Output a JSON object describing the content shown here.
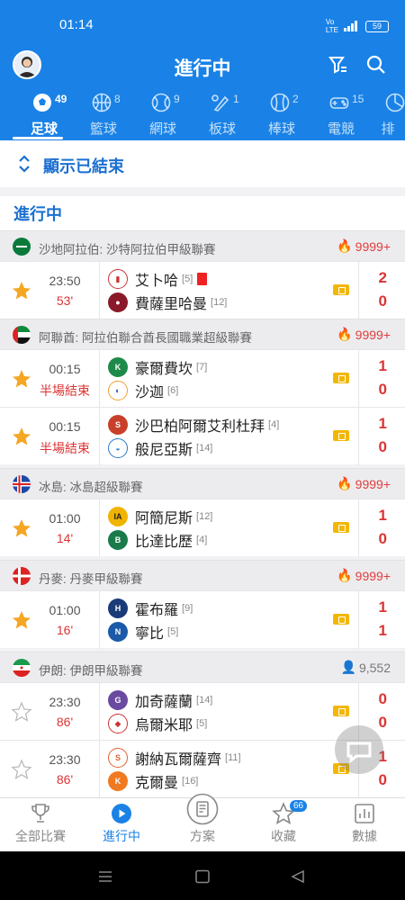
{
  "status": {
    "time": "01:14",
    "battery": "59"
  },
  "header": {
    "title": "進行中"
  },
  "sport_tabs": [
    {
      "label": "足球",
      "count": "49",
      "icon": "soccer-icon"
    },
    {
      "label": "籃球",
      "count": "8",
      "icon": "basketball-icon"
    },
    {
      "label": "網球",
      "count": "9",
      "icon": "tennis-icon"
    },
    {
      "label": "板球",
      "count": "1",
      "icon": "cricket-icon"
    },
    {
      "label": "棒球",
      "count": "2",
      "icon": "baseball-icon"
    },
    {
      "label": "電競",
      "count": "15",
      "icon": "gamepad-icon"
    },
    {
      "label": "排",
      "count": "",
      "icon": "volleyball-icon"
    }
  ],
  "show_finished": "顯示已結束",
  "section_title": "進行中",
  "leagues": [
    {
      "name": "沙地阿拉伯: 沙特阿拉伯甲級聯賽",
      "heat": "9999+"
    },
    {
      "name": "阿聯酋: 阿拉伯聯合酋長國職業超級聯賽",
      "heat": "9999+"
    },
    {
      "name": "冰島: 冰島超級聯賽",
      "heat": "9999+"
    },
    {
      "name": "丹麥: 丹麥甲級聯賽",
      "heat": "9999+"
    },
    {
      "name": "伊朗: 伊朗甲級聯賽",
      "heat": "9,552"
    }
  ],
  "matches": [
    {
      "time": "23:50",
      "minute": "53'",
      "home": "艾卜哈",
      "home_rank": "[5]",
      "away": "費薩里哈曼",
      "away_rank": "[12]",
      "home_score": "2",
      "away_score": "0",
      "starred": true
    },
    {
      "time": "00:15",
      "minute": "半場結束",
      "home": "豪爾費坎",
      "home_rank": "[7]",
      "away": "沙迦",
      "away_rank": "[6]",
      "home_score": "1",
      "away_score": "0",
      "starred": true
    },
    {
      "time": "00:15",
      "minute": "半場結束",
      "home": "沙巴柏阿爾艾利杜拜",
      "home_rank": "[4]",
      "away": "般尼亞斯",
      "away_rank": "[14]",
      "home_score": "1",
      "away_score": "0",
      "starred": true
    },
    {
      "time": "01:00",
      "minute": "14'",
      "home": "阿簡尼斯",
      "home_rank": "[12]",
      "away": "比達比歷",
      "away_rank": "[4]",
      "home_score": "1",
      "away_score": "0",
      "starred": true
    },
    {
      "time": "01:00",
      "minute": "16'",
      "home": "霍布羅",
      "home_rank": "[9]",
      "away": "寧比",
      "away_rank": "[5]",
      "home_score": "1",
      "away_score": "1",
      "starred": true
    },
    {
      "time": "23:30",
      "minute": "86'",
      "home": "加奇薩蘭",
      "home_rank": "[14]",
      "away": "烏爾米耶",
      "away_rank": "[5]",
      "home_score": "0",
      "away_score": "0",
      "starred": false
    },
    {
      "time": "23:30",
      "minute": "86'",
      "home": "謝納瓦爾薩齊",
      "home_rank": "[11]",
      "away": "克爾曼",
      "away_rank": "[16]",
      "home_score": "1",
      "away_score": "0",
      "starred": false
    }
  ],
  "bottom_nav": [
    {
      "label": "全部比賽",
      "icon": "trophy-icon"
    },
    {
      "label": "進行中",
      "icon": "play-icon"
    },
    {
      "label": "方案",
      "icon": "document-icon"
    },
    {
      "label": "收藏",
      "icon": "star-icon",
      "badge": "66"
    },
    {
      "label": "數據",
      "icon": "stats-icon"
    }
  ],
  "colors": {
    "brand": "#1a82e6",
    "live": "#dd3333",
    "star": "#f5a623"
  }
}
